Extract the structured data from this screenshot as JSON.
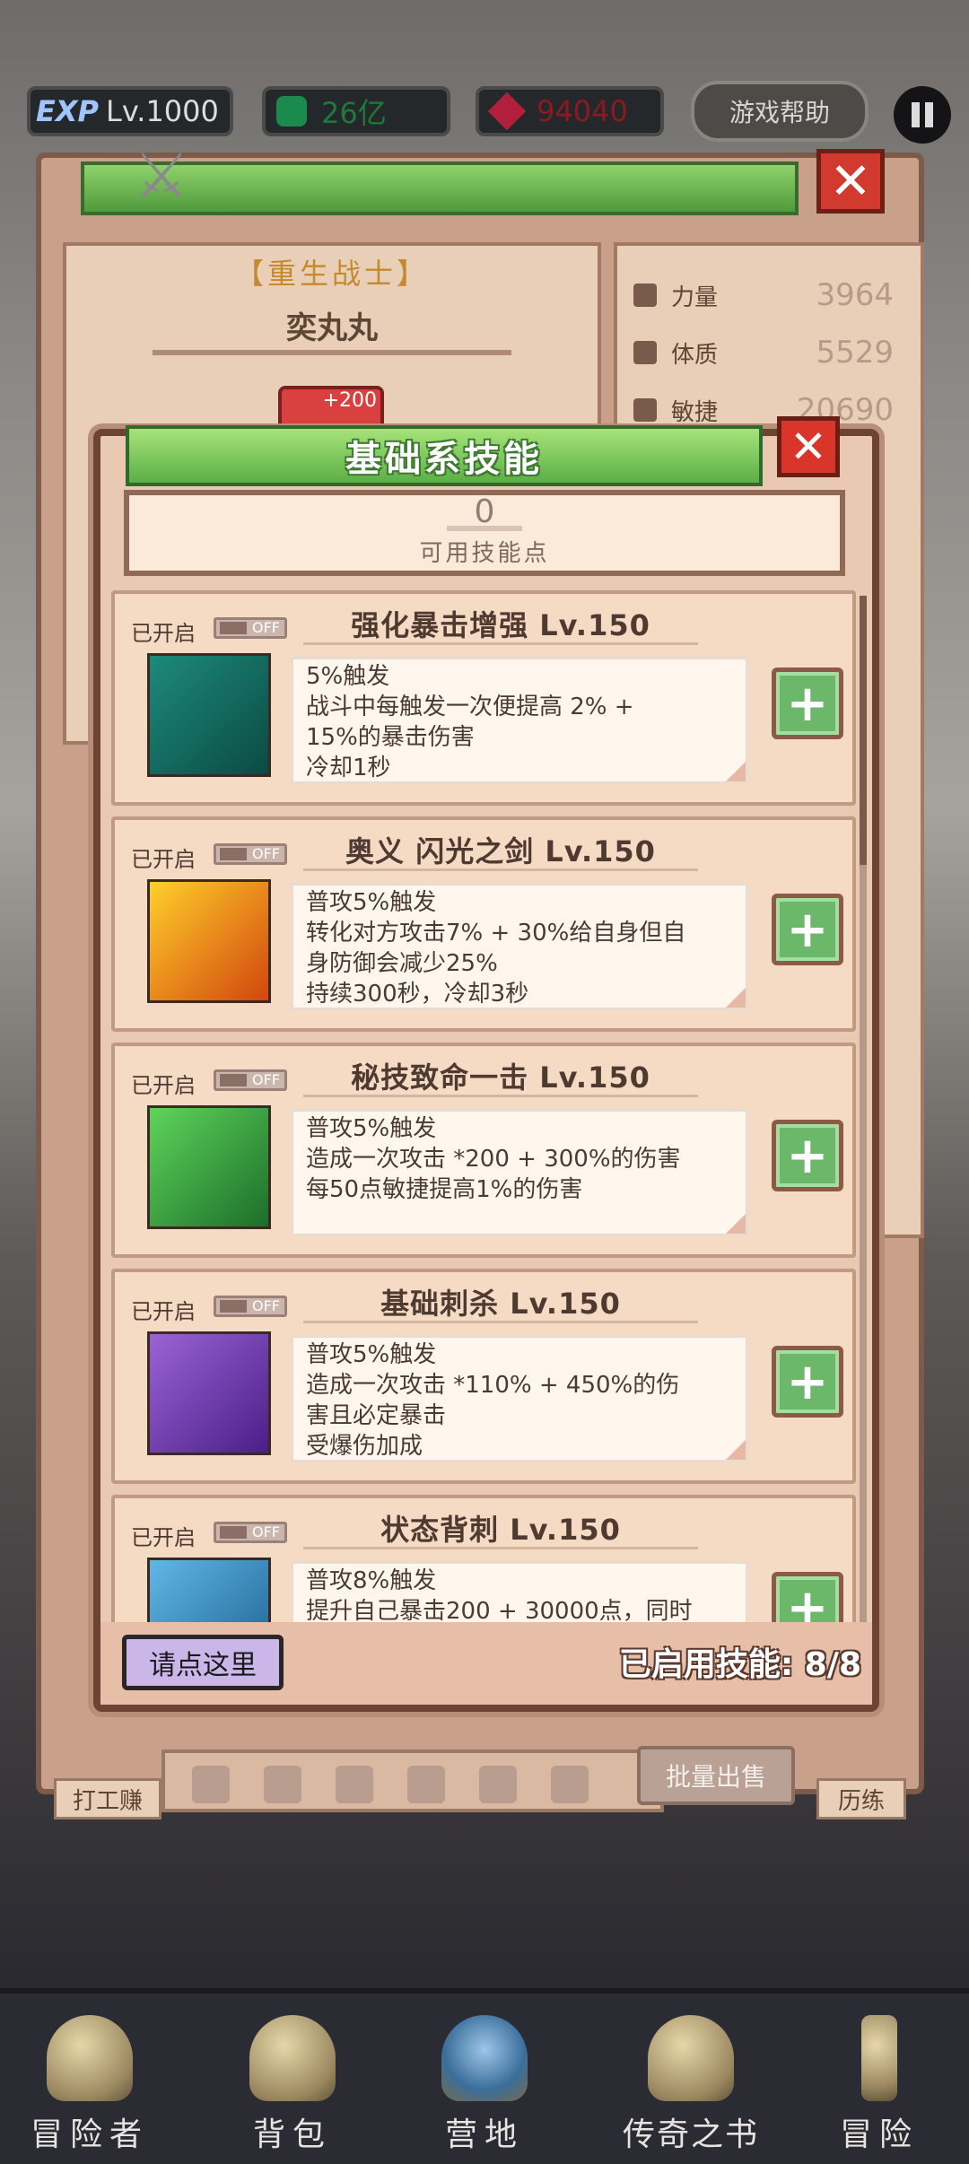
{
  "topbar": {
    "exp_badge": "EXP",
    "level": "Lv.1000",
    "gold": "26亿",
    "gems": "94040",
    "help": "游戏帮助"
  },
  "character": {
    "class": "【重生战士】",
    "name": "奕丸丸",
    "badge": "+200"
  },
  "stats": [
    {
      "label": "力量",
      "value": "3964"
    },
    {
      "label": "体质",
      "value": "5529"
    },
    {
      "label": "敏捷",
      "value": "20690"
    }
  ],
  "back_panel": {
    "batch_sell": "批量出售",
    "work": "打工赚",
    "train": "历练"
  },
  "modal": {
    "title": "基础系技能",
    "points_value": "0",
    "points_label": "可用技能点",
    "help_button": "请点这里",
    "enabled_count": "已启用技能: 8/8"
  },
  "skills": [
    {
      "enabled_label": "已开启",
      "toggle": "OFF",
      "title": "强化暴击增强 Lv.150",
      "icon": "sword-shield-icon",
      "desc": [
        "5%触发",
        "战斗中每触发一次便提高 2% +",
        "15%的暴击伤害",
        "冷却1秒"
      ],
      "color_a": "#1d8a7a",
      "color_b": "#0b4a44"
    },
    {
      "enabled_label": "已开启",
      "toggle": "OFF",
      "title": "奥义 闪光之剑 Lv.150",
      "icon": "flash-sword-icon",
      "desc": [
        "普攻5%触发",
        "转化对方攻击7% + 30%给自身但自",
        "身防御会减少25%",
        "持续300秒，冷却3秒"
      ],
      "color_a": "#ffcf2a",
      "color_b": "#d2460e"
    },
    {
      "enabled_label": "已开启",
      "toggle": "OFF",
      "title": "秘技致命一击 Lv.150",
      "icon": "assassin-icon",
      "desc": [
        "普攻5%触发",
        "造成一次攻击 *200 + 300%的伤害",
        "每50点敏捷提高1%的伤害"
      ],
      "color_a": "#5ed45a",
      "color_b": "#1c6e2a"
    },
    {
      "enabled_label": "已开启",
      "toggle": "OFF",
      "title": "基础刺杀 Lv.150",
      "icon": "dagger-icon",
      "desc": [
        "普攻5%触发",
        "造成一次攻击 *110% + 450%的伤",
        "害且必定暴击",
        "受爆伤加成"
      ],
      "color_a": "#9b63d6",
      "color_b": "#4a1f86"
    },
    {
      "enabled_label": "已开启",
      "toggle": "OFF",
      "title": "状态背刺 Lv.150",
      "icon": "backstab-icon",
      "desc": [
        "普攻8%触发",
        "提升自己暴击200 + 30000点，同时"
      ],
      "color_a": "#5fb8e6",
      "color_b": "#1c5e8e"
    }
  ],
  "nav": [
    {
      "label": "冒险者",
      "icon": "crown-icon"
    },
    {
      "label": "背包",
      "icon": "backpack-icon"
    },
    {
      "label": "营地",
      "icon": "camp-icon"
    },
    {
      "label": "传奇之书",
      "icon": "book-icon"
    },
    {
      "label": "冒险",
      "icon": "sword-icon"
    }
  ]
}
